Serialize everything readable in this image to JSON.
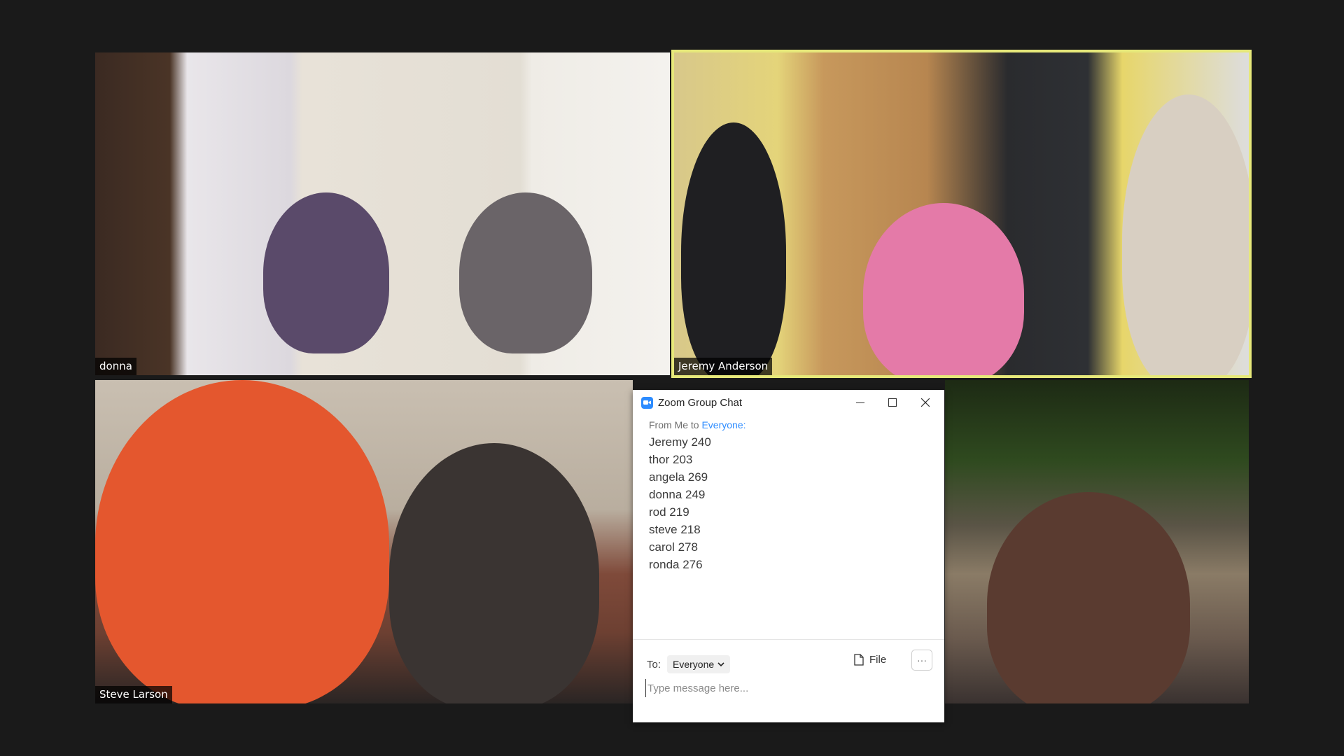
{
  "participants": [
    {
      "name": "donna"
    },
    {
      "name": "Jeremy Anderson"
    },
    {
      "name": "Steve Larson"
    },
    {
      "name": ""
    }
  ],
  "chat": {
    "title": "Zoom Group Chat",
    "from_prefix": "From Me to ",
    "from_target": "Everyone:",
    "messages": [
      "Jeremy 240",
      "thor 203",
      "angela 269",
      "donna 249",
      "rod 219",
      "steve 218",
      "carol 278",
      "ronda 276"
    ],
    "to_label": "To:",
    "to_value": "Everyone",
    "file_label": "File",
    "more_label": "···",
    "placeholder": "Type message here..."
  },
  "colors": {
    "background": "#1a1a1a",
    "active_speaker_border": "#e6e87a",
    "link": "#2d8cff"
  },
  "icons": [
    "zoom-logo-icon",
    "minimize-icon",
    "maximize-icon",
    "close-icon",
    "chevron-down-icon",
    "file-icon",
    "more-icon"
  ]
}
